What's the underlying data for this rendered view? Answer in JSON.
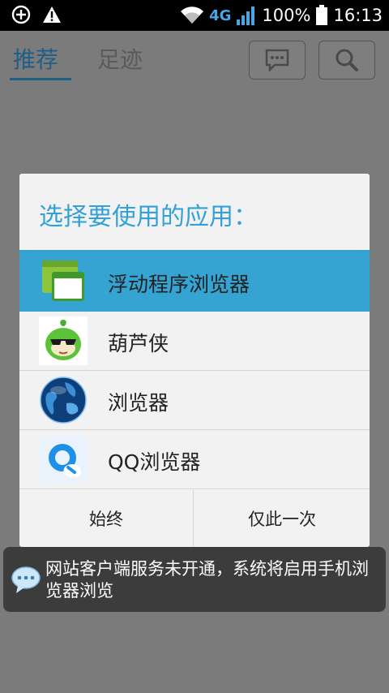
{
  "status_bar": {
    "network": "4G",
    "battery": "100%",
    "time": "16:13"
  },
  "app": {
    "tabs": [
      {
        "label": "推荐"
      },
      {
        "label": "足迹"
      }
    ]
  },
  "dialog": {
    "title": "选择要使用的应用：",
    "apps": [
      {
        "label": "浮动程序浏览器",
        "icon": "floating-browser-icon"
      },
      {
        "label": "葫芦侠",
        "icon": "huluxia-icon"
      },
      {
        "label": "浏览器",
        "icon": "globe-icon"
      },
      {
        "label": "QQ浏览器",
        "icon": "qq-browser-icon"
      }
    ],
    "buttons": {
      "always": "始终",
      "just_once": "仅此一次"
    }
  },
  "toast": {
    "text": "网站客户端服务未开通，系统将启用手机浏览器浏览"
  },
  "colors": {
    "accent": "#33a1d6",
    "selected_row": "#36a4d3",
    "dialog_bg": "#f2f2f2",
    "toast_bg": "#3c3c3c"
  }
}
